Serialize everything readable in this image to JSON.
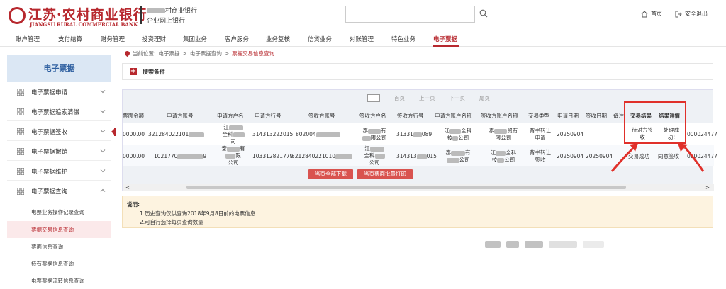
{
  "header": {
    "logo_cn": "江苏·农村商业银行",
    "logo_en": "JIANGSU RURAL COMMERCIAL BANK",
    "bank_sub_1": "村商业银行",
    "bank_sub_2": "企业网上银行",
    "search_placeholder": "",
    "home_label": "首页",
    "logout_label": "安全退出"
  },
  "nav": {
    "items": [
      "账户管理",
      "支付结算",
      "财务管理",
      "投资理财",
      "集团业务",
      "客户服务",
      "业务复核",
      "信贷业务",
      "对账管理",
      "特色业务",
      "电子票据"
    ],
    "active": "电子票据"
  },
  "sidebar": {
    "title": "电子票据",
    "items": [
      {
        "label": "电子票据申请"
      },
      {
        "label": "电子票据追索清偿"
      },
      {
        "label": "电子票据签收"
      },
      {
        "label": "电子票据撤销"
      },
      {
        "label": "电子票据维护"
      },
      {
        "label": "电子票据查询"
      }
    ],
    "sub_items": [
      {
        "label": "电票业务操作记录查询"
      },
      {
        "label": "票据交易信息查询"
      },
      {
        "label": "票面信息查询"
      },
      {
        "label": "持有票据信息查询"
      },
      {
        "label": "电票票据流转信息查询"
      }
    ]
  },
  "breadcrumb": {
    "prefix": "当前位置:",
    "parts": [
      "电子票据",
      "电子票据查询"
    ],
    "current": "票据交易信息查询"
  },
  "search_condition": {
    "label": "搜索条件"
  },
  "pager": {
    "first": "首页",
    "prev": "上一页",
    "next": "下一页",
    "last": "尾页"
  },
  "table": {
    "headers": [
      "票面金额",
      "申请方账号",
      "申请方户名",
      "申请方行号",
      "签收方账号",
      "签收方户名",
      "签收方行号",
      "申请方账户名称",
      "签收方账户名称",
      "交易类型",
      "申请日期",
      "签收日期",
      "备注",
      "交易结果",
      "结果详情"
    ],
    "rows": [
      {
        "amount": "0000.00",
        "applicant_account": "321284022101",
        "applicant_name_a": "江",
        "applicant_name_b": "全科",
        "applicant_name_c": "司",
        "applicant_bank": "314313222015",
        "receiver_account": "802004",
        "receiver_name_a": "泰",
        "receiver_name_b": "有",
        "receiver_name_c": "限公司",
        "receiver_bank": "31331",
        "receiver_bank_tail": "089",
        "applicant_acct_name_a": "江",
        "applicant_acct_name_b": "全科",
        "applicant_acct_name_c": "技",
        "applicant_acct_name_d": "公司",
        "receiver_acct_name_a": "泰",
        "receiver_acct_name_b": "贸有",
        "receiver_acct_name_c": "限公司",
        "trade_type_a": "背书转让",
        "trade_type_b": "申请",
        "apply_date": "20250904",
        "sign_date": "",
        "result_a": "待对方签",
        "result_b": "收",
        "detail_a": "处理成",
        "detail_b": "功!",
        "tail": "000024477"
      },
      {
        "amount": "0000.00",
        "applicant_account": "1021770",
        "applicant_account_tail": "9",
        "applicant_name_a": "泰",
        "applicant_name_b": "有",
        "applicant_name_c": "限",
        "applicant_name_d": "公司",
        "applicant_bank": "103312821779",
        "receiver_account": "3212840221010",
        "receiver_name_a": "江",
        "receiver_name_b": "全科",
        "receiver_name_c": "公司",
        "receiver_bank": "314313",
        "receiver_bank_tail": "015",
        "applicant_acct_name_a": "泰",
        "applicant_acct_name_b": "有",
        "applicant_acct_name_c": "公司",
        "receiver_acct_name_a": "江",
        "receiver_acct_name_b": "全科",
        "receiver_acct_name_c": "技",
        "receiver_acct_name_d": "公司",
        "trade_type_a": "背书转让",
        "trade_type_b": "签收",
        "apply_date": "20250904",
        "sign_date": "20250904",
        "result": "交易成功",
        "detail": "同意签收",
        "tail": "000024477"
      }
    ]
  },
  "buttons": {
    "download_all": "当页全部下载",
    "batch_print": "当页票面批量打印"
  },
  "notice": {
    "title": "说明:",
    "lines": [
      "1.历史查询仅供查询2018年9月8日前的电票信息",
      "2.可自行选择每页查询数量"
    ]
  },
  "colors": {
    "brand": "#b7282e",
    "highlight": "#e0302a",
    "sidebar_bg": "#dbe7f4"
  }
}
